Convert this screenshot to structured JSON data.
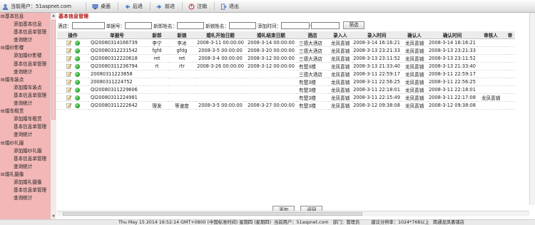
{
  "header": {
    "user_label": "当前用户：51aspnet.com",
    "nav": [
      {
        "label": "桌面",
        "icon": "desktop-icon"
      },
      {
        "label": "后退",
        "icon": "back-arrow-icon"
      },
      {
        "label": "前进",
        "icon": "forward-arrow-icon"
      },
      {
        "label": "注销",
        "icon": "logout-icon"
      },
      {
        "label": "退出",
        "icon": "exit-icon"
      }
    ]
  },
  "sidebar": {
    "groups": [
      {
        "title": "基本信息",
        "items": [
          "添加基本信息",
          "基本信息单管理",
          "查询统计"
        ]
      },
      {
        "title": "婚纱影楼",
        "items": [
          "添加婚纱影楼",
          "基本信息单管理",
          "查询统计"
        ]
      },
      {
        "title": "婚车装点",
        "items": [
          "添加婚车装点",
          "基本信息单管理",
          "查询统计"
        ]
      },
      {
        "title": "婚车租赁",
        "items": [
          "添加婚车租赁",
          "基本信息单管理",
          "查询统计"
        ]
      },
      {
        "title": "婚纱礼服",
        "items": [
          "添加婚纱礼服",
          "基本信息单管理",
          "查询统计"
        ]
      },
      {
        "title": "婚礼摄像",
        "items": [
          "添加婚礼摄像",
          "基本信息单管理",
          "查询统计"
        ]
      }
    ]
  },
  "main": {
    "title": "基本信息管理",
    "filter": {
      "hotel_label": "酒店：",
      "order_label": "单据号：",
      "groom_label": "新郎姓名：",
      "bride_label": "新娘姓名：",
      "added_label": "添加时间：",
      "date_sep": "-",
      "search_button": "筛选"
    },
    "columns": [
      "操作",
      "单据号",
      "新郎",
      "新娘",
      "婚礼开始日期",
      "婚礼结束日期",
      "酒店",
      "录入人",
      "录入时间",
      "确认人",
      "确认时间",
      "审核人",
      "审"
    ],
    "rows": [
      [
        "QI20080314166739",
        "李宁",
        "李冰",
        "2008-3-11 00:00:00",
        "2008-3-14 00:00:00",
        "三德大酒店",
        "龙凤喜铺",
        "2008-3-14 16:16:21",
        "龙凤喜铺",
        "2008-3-14 16:16:21",
        ""
      ],
      [
        "QI20080312231542",
        "fgfd",
        "gfdg",
        "2008-3-5 00:00:00",
        "2008-3-20 00:00:00",
        "三德大酒店",
        "龙凤喜铺",
        "2008-3-13 23:21:33",
        "龙凤喜铺",
        "2008-3-13 23:21:33",
        ""
      ],
      [
        "QI20080312220618",
        "ret",
        "ret",
        "2008-3-4 00:00:00",
        "2008-3-12 00:00:00",
        "三德大酒店",
        "龙凤喜铺",
        "2008-3-13 23:11:52",
        "龙凤喜铺",
        "2008-3-13 23:11:52",
        ""
      ],
      [
        "QI20080311236794",
        "rt",
        "rtr",
        "2008-3-26 00:00:00",
        "2008-3-12 00:00:00",
        "有楚3楼",
        "龙凤喜铺",
        "2008-3-13 21:33:40",
        "龙凤喜铺",
        "2008-3-13 21:33:40",
        ""
      ],
      [
        "20080311223858",
        "",
        "",
        "",
        "",
        "三德大酒店",
        "龙凤喜铺",
        "2008-3-11 22:59:17",
        "龙凤喜铺",
        "2008-3-11 22:59:17",
        ""
      ],
      [
        "20080311224752",
        "",
        "",
        "",
        "",
        "有楚3楼",
        "龙凤喜铺",
        "2008-3-11 22:56:25",
        "龙凤喜铺",
        "2008-3-11 22:56:25",
        ""
      ],
      [
        "QI20080311229606",
        "",
        "",
        "",
        "",
        "有楚3楼",
        "龙凤喜铺",
        "2008-3-11 22:18:01",
        "龙凤喜铺",
        "2008-3-11 22:18:01",
        ""
      ],
      [
        "QI20080311224981",
        "",
        "",
        "",
        "",
        "有楚3楼",
        "龙凤喜铺",
        "2008-3-11 22:15:49",
        "龙凤喜铺",
        "2008-3-11 22:17:08",
        "龙凤喜铺"
      ],
      [
        "QI20080311222642",
        "理发",
        "等速度",
        "2008-3-5 00:00:00",
        "2008-3-27 00:00:00",
        "有楚3楼",
        "龙凤喜铺",
        "2008-3-12 09:38:08",
        "龙凤喜铺",
        "2008-3-12 09:38:08",
        ""
      ]
    ],
    "add_button": "添加",
    "back_button": "返回"
  },
  "statusbar": {
    "datetime": "Thu May 15 2014 16:52:14 GMT+0800 (中国标准时间) 星期四 (星期四)",
    "user": "当前用户：51aspnet.com",
    "dept": "部门：管理员",
    "resolution": "建议分辨率：1024*768以上",
    "company": "南通龙凤喜铺店"
  },
  "colors": {
    "sidebar_bg": "#f3b7b7",
    "title_red": "#b21313",
    "status_green": "#1f9b1f"
  }
}
